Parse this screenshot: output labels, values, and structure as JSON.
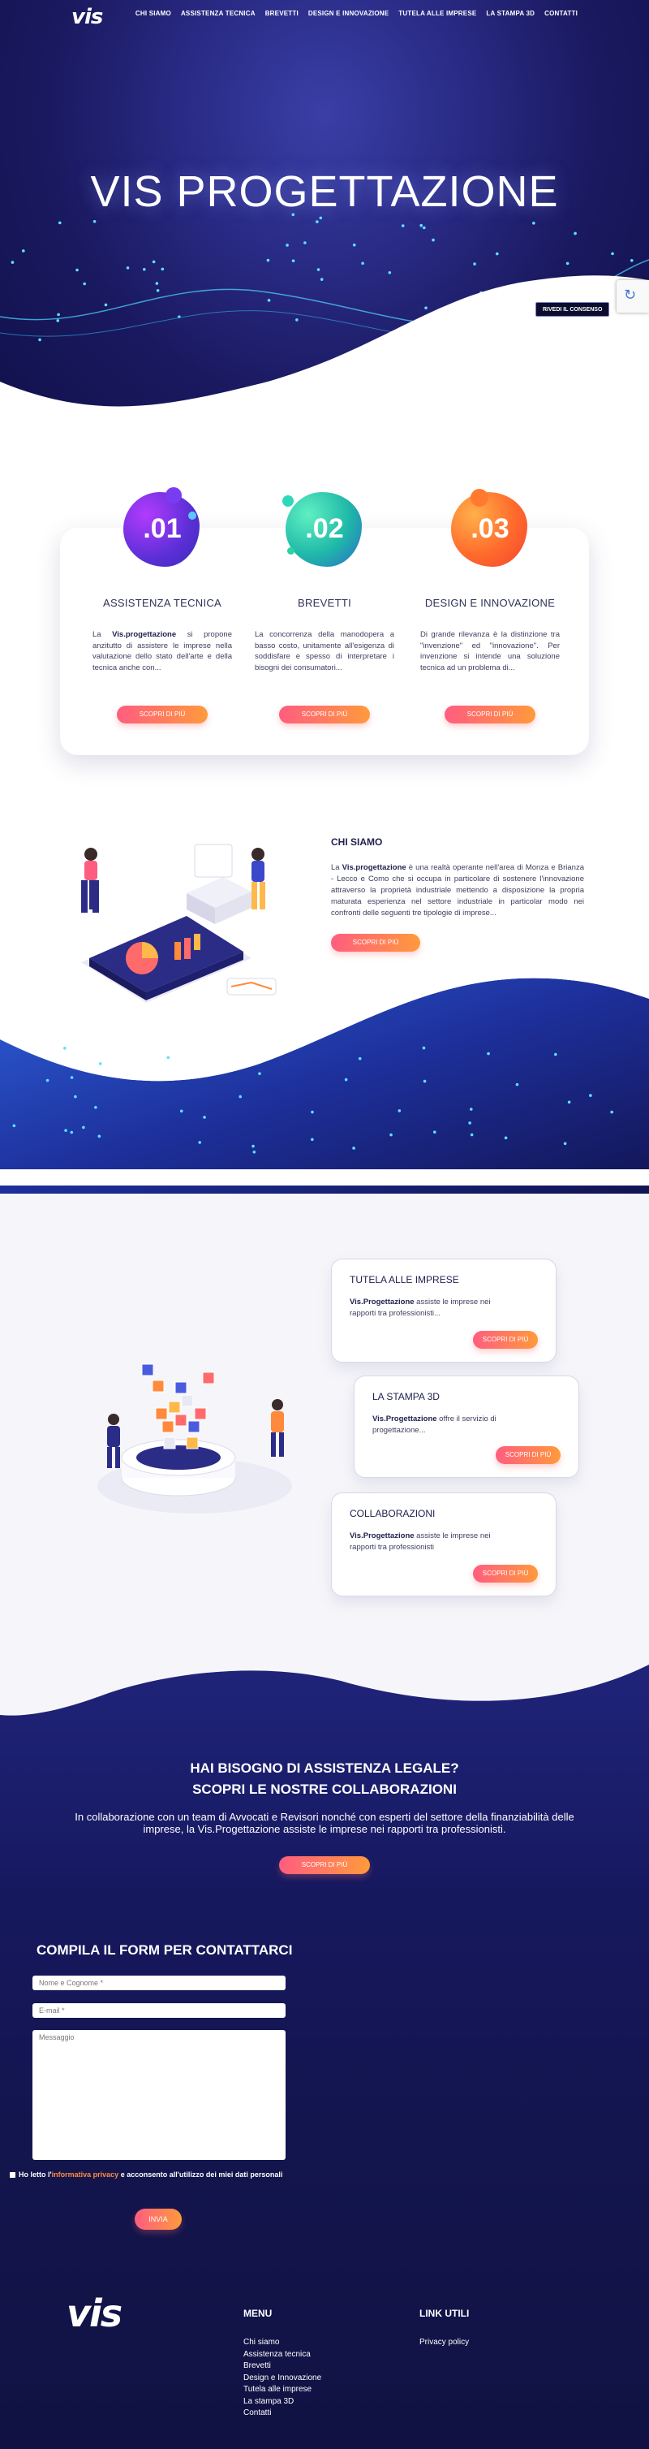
{
  "header": {
    "logo": "vis",
    "nav": [
      "CHI SIAMO",
      "ASSISTENZA TECNICA",
      "BREVETTI",
      "DESIGN E INNOVAZIONE",
      "TUTELA ALLE IMPRESE",
      "LA STAMPA 3D",
      "CONTATTI"
    ]
  },
  "hero": {
    "title": "VIS PROGETTAZIONE",
    "consent_label": "RIVEDI IL CONSENSO"
  },
  "services": [
    {
      "num": ".01",
      "title": "ASSISTENZA TECNICA",
      "text_pre": "La ",
      "text_bold": "Vis.progettazione",
      "text_post": " si propone anzitutto di assistere le imprese nella valutazione dello stato dell'arte e della tecnica anche con...",
      "button": "SCOPRI DI PIÙ"
    },
    {
      "num": ".02",
      "title": "BREVETTI",
      "text_pre": "",
      "text_bold": "",
      "text_post": "La concorrenza della manodopera a basso costo, unitamente all'esigenza di soddisfare e spesso di interpretare i bisogni dei consumatori...",
      "button": "SCOPRI DI PIÙ"
    },
    {
      "num": ".03",
      "title": "DESIGN E INNOVAZIONE",
      "text_pre": "",
      "text_bold": "",
      "text_post": "Di grande rilevanza è la distinzione tra \"invenzione\" ed \"innovazione\". Per invenzione si intende una soluzione tecnica ad un problema di...",
      "button": "SCOPRI DI PIÙ"
    }
  ],
  "about": {
    "title": "CHI SIAMO",
    "text_pre": "La ",
    "text_bold": "Vis.progettazione",
    "text_post": " è una realtà operante nell'area di Monza e Brianza - Lecco e Como che si occupa in particolare di sostenere l'innovazione attraverso la proprietà industriale mettendo a disposizione la propria maturata esperienza nel settore industriale in particolar modo nei confronti delle seguenti tre tipologie di imprese...",
    "button": "SCOPRI DI PIÙ"
  },
  "features": [
    {
      "title": "TUTELA ALLE IMPRESE",
      "bold": "Vis.Progettazione",
      "text": " assiste le imprese nei rapporti tra professionisti...",
      "button": "SCOPRI DI PIÙ"
    },
    {
      "title": "LA STAMPA 3D",
      "bold": "Vis.Progettazione",
      "text": " offre il servizio di progettazione...",
      "button": "SCOPRI DI PIÙ"
    },
    {
      "title": "COLLABORAZIONI",
      "bold": "Vis.Progettazione",
      "text": " assiste le imprese nei rapporti tra professionisti",
      "button": "SCOPRI DI PIÙ"
    }
  ],
  "cta": {
    "title_line1": "HAI BISOGNO DI ASSISTENZA LEGALE?",
    "title_line2": "SCOPRI LE NOSTRE COLLABORAZIONI",
    "text": "In collaborazione con un team di Avvocati e Revisori nonché con esperti del settore della finanziabilità delle imprese, la Vis.Progettazione assiste le imprese nei rapporti tra professionisti.",
    "button": "SCOPRI DI PIÙ"
  },
  "form": {
    "title": "COMPILA IL FORM PER CONTATTARCI",
    "name_placeholder": "Nome e Cognome *",
    "email_placeholder": "E-mail *",
    "message_placeholder": "Messaggio",
    "privacy_pre": "Ho letto l'",
    "privacy_link": "informativa privacy",
    "privacy_post": " e acconsento all'utilizzo dei miei dati personali",
    "submit": "INVIA"
  },
  "footer": {
    "logo": "vis",
    "menu_title": "MENU",
    "menu": [
      "Chi siamo",
      "Assistenza tecnica",
      "Brevetti",
      "Design e Innovazione",
      "Tutela alle imprese",
      "La stampa 3D",
      "Contatti"
    ],
    "links_title": "LINK UTILI",
    "links": [
      "Privacy policy"
    ]
  },
  "colors": {
    "accent_gradient_start": "#ff5d7f",
    "accent_gradient_end": "#ff9a3c",
    "navy": "#1a1960"
  }
}
